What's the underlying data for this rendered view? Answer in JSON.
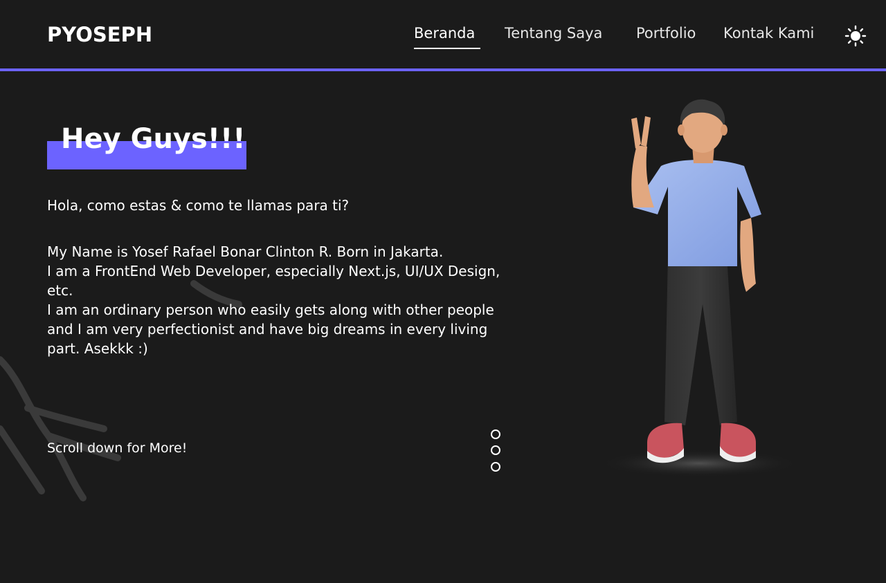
{
  "header": {
    "logo": "PYOSEPH",
    "nav": [
      {
        "label": "Beranda",
        "active": true
      },
      {
        "label": "Tentang Saya",
        "active": false
      },
      {
        "label": "Portfolio",
        "active": false
      },
      {
        "label": "Kontak Kami",
        "active": false
      }
    ],
    "theme_icon": "sun-icon"
  },
  "hero": {
    "title": "Hey Guys!!!",
    "greeting": "Hola, como estas & como te llamas para ti?",
    "bio_lines": [
      "My Name is Yosef Rafael Bonar Clinton R. Born in Jakarta.",
      "I am a FrontEnd Web Developer, especially Next.js, UI/UX Design, etc.",
      "I am an ordinary person who easily gets along with other people and I am very perfectionist and have big dreams in every living part. Asekkk :)"
    ],
    "scroll_hint": "Scroll down for More!",
    "slide_dots": 3
  },
  "colors": {
    "background": "#1b1b1b",
    "accent": "#6c63ff",
    "text": "#ffffff"
  }
}
